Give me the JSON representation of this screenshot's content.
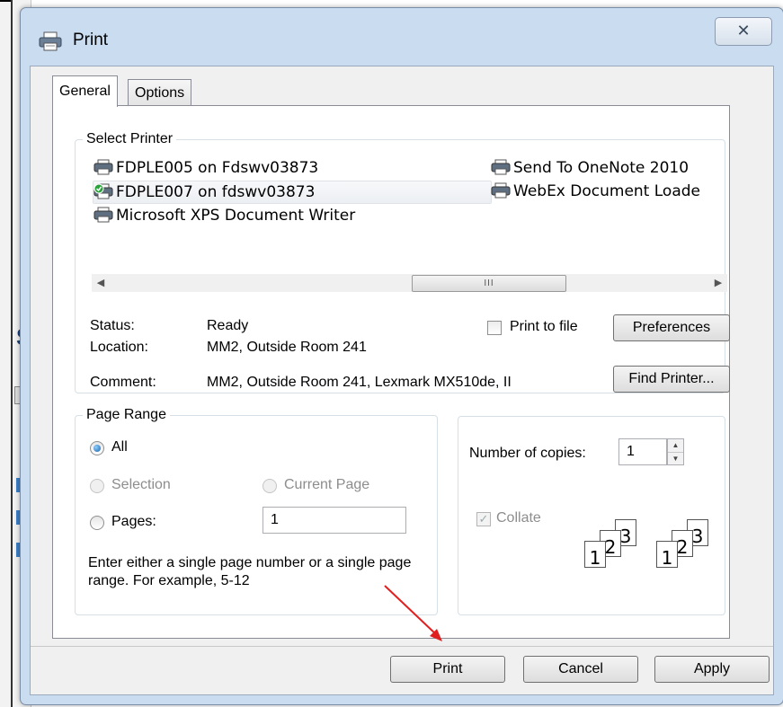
{
  "window": {
    "title": "Print",
    "close_glyph": "✕"
  },
  "tabs": [
    {
      "label": "General",
      "active": true
    },
    {
      "label": "Options",
      "active": false
    }
  ],
  "select_printer": {
    "legend": "Select Printer",
    "printers": [
      {
        "name": "FDPLE005 on Fdswv03873",
        "icon": "printer-icon"
      },
      {
        "name": "FDPLE007 on fdswv03873",
        "icon": "default-printer-icon",
        "selected": true
      },
      {
        "name": "Microsoft XPS Document Writer",
        "icon": "printer-icon"
      },
      {
        "name": "Send To OneNote 2010",
        "icon": "printer-icon"
      },
      {
        "name": "WebEx Document Loade",
        "icon": "printer-icon"
      }
    ],
    "scroll_thumb_glyph": "III",
    "status_label": "Status:",
    "status_value": "Ready",
    "location_label": "Location:",
    "location_value": "MM2, Outside Room 241",
    "comment_label": "Comment:",
    "comment_value": "MM2, Outside Room 241, Lexmark MX510de, II",
    "print_to_file_label": "Print to file",
    "preferences_button": "Preferences",
    "find_printer_button": "Find Printer..."
  },
  "page_range": {
    "legend": "Page Range",
    "all_label": "All",
    "selection_label": "Selection",
    "current_page_label": "Current Page",
    "pages_label": "Pages:",
    "pages_value": "1",
    "help_text": "Enter either a single page number or a single page range.  For example, 5-12"
  },
  "copies": {
    "number_label": "Number of copies:",
    "number_value": "1",
    "collate_label": "Collate",
    "page_digits": [
      "1",
      "2",
      "3"
    ]
  },
  "buttons": {
    "print": "Print",
    "cancel": "Cancel",
    "apply": "Apply"
  },
  "colors": {
    "annotation_arrow": "#e02020",
    "window_frame": "#c9dcf0"
  }
}
